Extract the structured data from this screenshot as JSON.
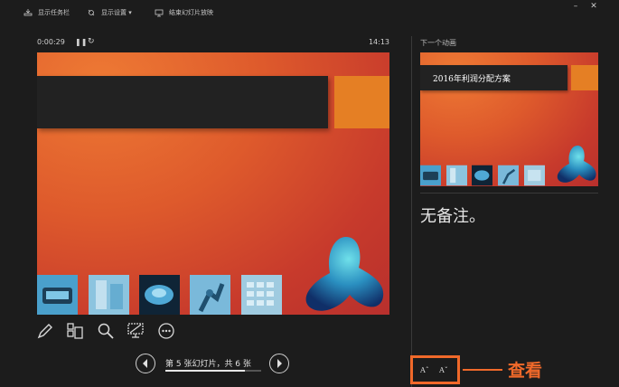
{
  "toolbar": {
    "show_taskbar": "显示任务栏",
    "display_settings": "显示设置 ▾",
    "end_slideshow": "结束幻灯片放映"
  },
  "window": {
    "minimize": "–",
    "close": "✕"
  },
  "presenter": {
    "timer": "0:00:29",
    "clock": "14:13"
  },
  "next_panel": {
    "label": "下一个动画",
    "slide_title": "2016年利润分配方案",
    "notes": "无备注。"
  },
  "navigation": {
    "slide_counter": "第 5 张幻灯片，共 6 张",
    "progress": 0.833
  },
  "icons": {
    "tools": [
      "pen-icon",
      "slides-grid-icon",
      "zoom-icon",
      "screen-icon",
      "more-icon"
    ]
  },
  "annotation": {
    "callout": "查看",
    "color": "#f0692a"
  }
}
